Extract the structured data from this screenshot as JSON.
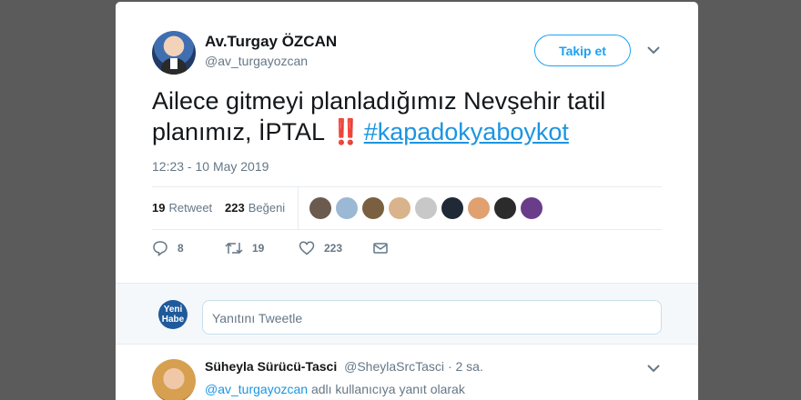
{
  "tweet": {
    "display_name": "Av.Turgay ÖZCAN",
    "handle": "@av_turgayozcan",
    "follow_label": "Takip et",
    "text_main": "Ailece gitmeyi planladığımız Nevşehir tatil planımız, İPTAL",
    "text_emoji": "‼️",
    "hashtag": "#kapadokyaboykot",
    "timestamp": "12:23 - 10 May 2019"
  },
  "stats": {
    "retweet_count": "19",
    "retweet_label": "Retweet",
    "like_count": "223",
    "like_label": "Beğeni"
  },
  "liker_avatar_colors": [
    "#6b5a4e",
    "#9bb8d4",
    "#7a6040",
    "#d9b38c",
    "#c8c8c8",
    "#1f2a36",
    "#e0a070",
    "#2b2b2b",
    "#6a3d8a"
  ],
  "actions": {
    "reply_count": "8",
    "retweet_count": "19",
    "like_count": "223"
  },
  "reply_box": {
    "avatar_text_1": "Yeni",
    "avatar_text_2": "Habe",
    "placeholder": "Yanıtını Tweetle"
  },
  "first_reply": {
    "name": "Süheyla Sürücü-Tasci",
    "handle": "@SheylaSrcTasci",
    "time": "· 2 sa.",
    "mention": "@av_turgayozcan",
    "reply_suffix": "adlı kullanıcıya yanıt olarak"
  },
  "colors": {
    "accent": "#1da1f2",
    "link": "#1b95e0",
    "text": "#14171a",
    "muted": "#657786"
  }
}
